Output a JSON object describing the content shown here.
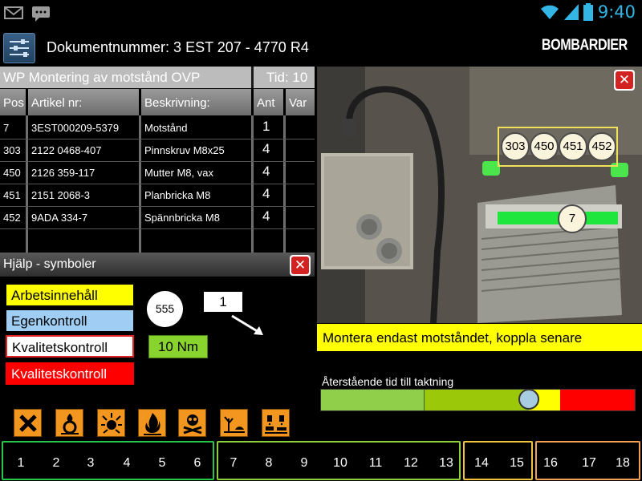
{
  "status_bar": {
    "time": "9:40",
    "left_icons": [
      "gmail-icon",
      "chat-icon"
    ],
    "right_icons": [
      "wifi-icon",
      "signal-icon",
      "battery-icon"
    ]
  },
  "header": {
    "document_label": "Dokumentnummer: 3 EST 207 - 4770 R4",
    "brand": "BOMBARDIER"
  },
  "work_package": {
    "title": "WP Montering av motstånd OVP",
    "time_label": "Tid: 10"
  },
  "parts_table": {
    "headers": {
      "pos": "Pos",
      "article": "Artikel nr:",
      "description": "Beskrivning:",
      "qty": "Ant",
      "var": "Var"
    },
    "rows": [
      {
        "pos": "7",
        "article": "3EST000209-5379",
        "description": "Motstånd",
        "qty": "1"
      },
      {
        "pos": "303",
        "article": "2122 0468-407",
        "description": "Pinnskruv M8x25",
        "qty": "4"
      },
      {
        "pos": "450",
        "article": "2126 359-117",
        "description": "Mutter M8, vax",
        "qty": "4"
      },
      {
        "pos": "451",
        "article": "2151 2068-3",
        "description": "Planbricka M8",
        "qty": "4"
      },
      {
        "pos": "452",
        "article": "9ADA 334-7",
        "description": "Spännbricka M8",
        "qty": "4"
      }
    ]
  },
  "help": {
    "title": "Hjälp - symboler",
    "legend": [
      {
        "label": "Arbetsinnehåll",
        "bg": "#ffff00",
        "fg": "#000000",
        "border": "#000000"
      },
      {
        "label": "Egenkontroll",
        "bg": "#9fcdf3",
        "fg": "#000000",
        "border": "#000000"
      },
      {
        "label": "Kvalitetskontroll",
        "bg": "#ffffff",
        "fg": "#000000",
        "border": "#e02020"
      },
      {
        "label": "Kvalitetskontroll",
        "bg": "#ff0000",
        "fg": "#ffffff",
        "border": "#ff0000"
      }
    ],
    "position_symbol": "555",
    "step_symbol": "1",
    "torque": "10 Nm",
    "hazard_icons": [
      "harmful-x-icon",
      "oxidizing-icon",
      "explosive-icon",
      "flammable-icon",
      "toxic-icon",
      "environment-icon",
      "corrosive-icon"
    ]
  },
  "photo": {
    "tags": [
      "303",
      "450",
      "451",
      "452"
    ],
    "main_tag": "7"
  },
  "instruction": "Montera endast motståndet, koppla senare",
  "timer": {
    "label": "Återstående tid till taktning",
    "progress": 0.66,
    "colors": [
      "#8fcf4a",
      "#9cc80a",
      "#ffff00",
      "#ff0000"
    ]
  },
  "steps": {
    "groups": [
      {
        "color": "#26c64a",
        "steps": [
          "1",
          "2",
          "3",
          "4",
          "5",
          "6"
        ]
      },
      {
        "color": "#8ecf3c",
        "steps": [
          "7",
          "8",
          "9",
          "10",
          "11",
          "12",
          "13"
        ]
      },
      {
        "color": "#f1c33a",
        "steps": [
          "14",
          "15"
        ]
      },
      {
        "color": "#f0a050",
        "steps": [
          "16",
          "17",
          "18"
        ]
      }
    ]
  }
}
